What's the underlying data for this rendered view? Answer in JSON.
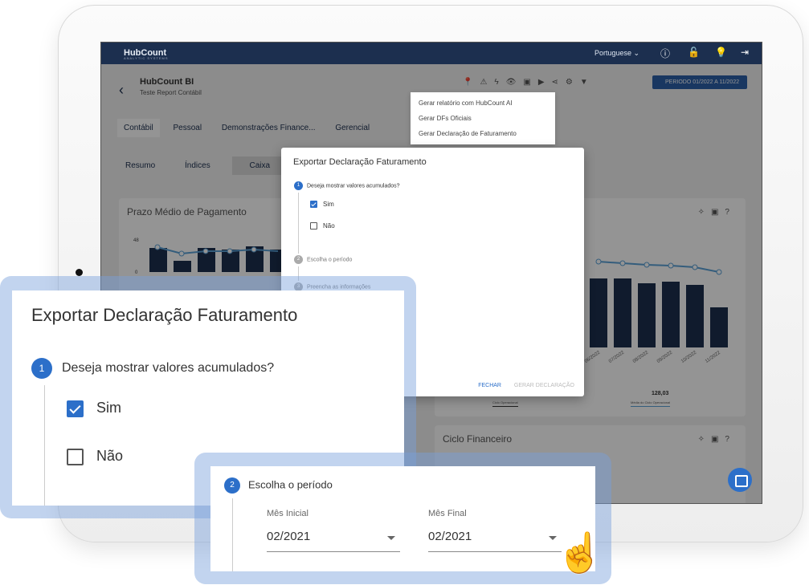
{
  "topbar": {
    "logo": "HubCount",
    "logo_sub": "ANALYTIC SYSTEMS",
    "language": "Portuguese ⌄"
  },
  "header": {
    "title": "HubCount BI",
    "subtitle": "Teste Report Contábil",
    "period_button": "PERIODO 01/2022 A 11/2022"
  },
  "tabs": [
    "Contábil",
    "Pessoal",
    "Demonstrações Finance...",
    "Gerencial"
  ],
  "subtabs": [
    "Resumo",
    "Índices",
    "Caixa"
  ],
  "dropdown_menu": [
    "Gerar relatório com HubCount AI",
    "Gerar DFs Oficiais",
    "Gerar Declaração de Faturamento"
  ],
  "cards": {
    "left_title": "Prazo Médio de Pagamento",
    "left_ymax": "48",
    "left_ymin": "0",
    "bottom_title": "Ciclo Financeiro",
    "right_value": "128,03",
    "right_caption": "Média do Ciclo Operacional",
    "left_caption": "Ciclo Operacional"
  },
  "x_ticks": [
    "06/2022",
    "07/2022",
    "08/2022",
    "09/2022",
    "10/2022",
    "11/2022"
  ],
  "modal": {
    "title": "Exportar Declaração Faturamento",
    "step1": "Deseja mostrar valores acumulados?",
    "opt_yes": "Sim",
    "opt_no": "Não",
    "step2": "Escolha o período",
    "step3": "Preencha as informações",
    "close": "FECHAR",
    "generate": "GERAR DECLARAÇÃO"
  },
  "zoom1": {
    "title": "Exportar Declaração Faturamento",
    "step_num": "1",
    "question": "Deseja mostrar valores acumulados?",
    "yes": "Sim",
    "no": "Não"
  },
  "zoom2": {
    "step_num": "2",
    "step": "Escolha o período",
    "start_label": "Mês Inicial",
    "start_value": "02/2021",
    "end_label": "Mês Final",
    "end_value": "02/2021"
  }
}
